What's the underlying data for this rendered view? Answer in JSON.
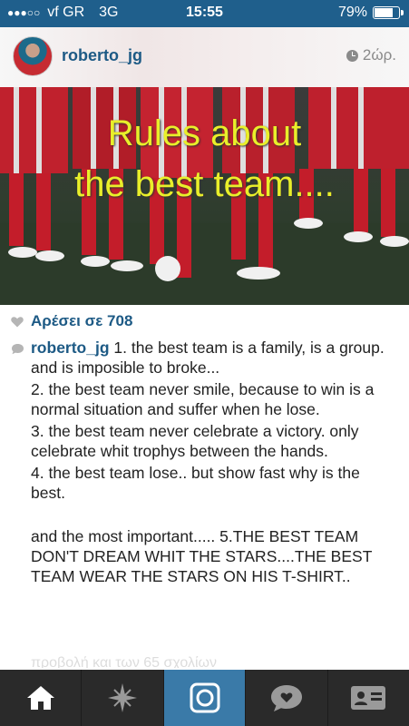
{
  "status_bar": {
    "signal_dots": "●●●○○",
    "carrier": "vf GR",
    "network": "3G",
    "time": "15:55",
    "battery_text": "79%",
    "battery_level": 0.79
  },
  "post": {
    "username": "roberto_jg",
    "time_ago": "2ώρ.",
    "photo_text_line1": "Rules about",
    "photo_text_line2": "the best team....",
    "likes": "Αρέσει σε 708",
    "caption_user": "roberto_jg",
    "caption_lines": [
      "1. the best team is a family, is a group. and is imposible to broke...",
      "2. the best team never smile, because to win is a normal situation and suffer when he lose.",
      "3. the best team never celebrate a victory. only celebrate whit trophys between the hands.",
      "4. the best team lose.. but show fast why is the best.",
      "",
      "and the most important..... 5.THE BEST TEAM DON'T DREAM WHIT THE STARS....THE BEST TEAM WEAR THE STARS ON HIS T-SHIRT.."
    ],
    "faded_next": "προβολή και των 65 σχολίων"
  },
  "tabbar": {
    "tabs": [
      {
        "icon": "home-icon",
        "active": false
      },
      {
        "icon": "explore-star-icon",
        "active": false
      },
      {
        "icon": "camera-icon",
        "active": true
      },
      {
        "icon": "activity-bubble-icon",
        "active": false
      },
      {
        "icon": "profile-card-icon",
        "active": false
      }
    ],
    "accent": "#3a7aa8"
  },
  "colors": {
    "status_bar": "#1f5f8c",
    "link": "#1d5a85",
    "photo_text": "#e9ef2a"
  }
}
